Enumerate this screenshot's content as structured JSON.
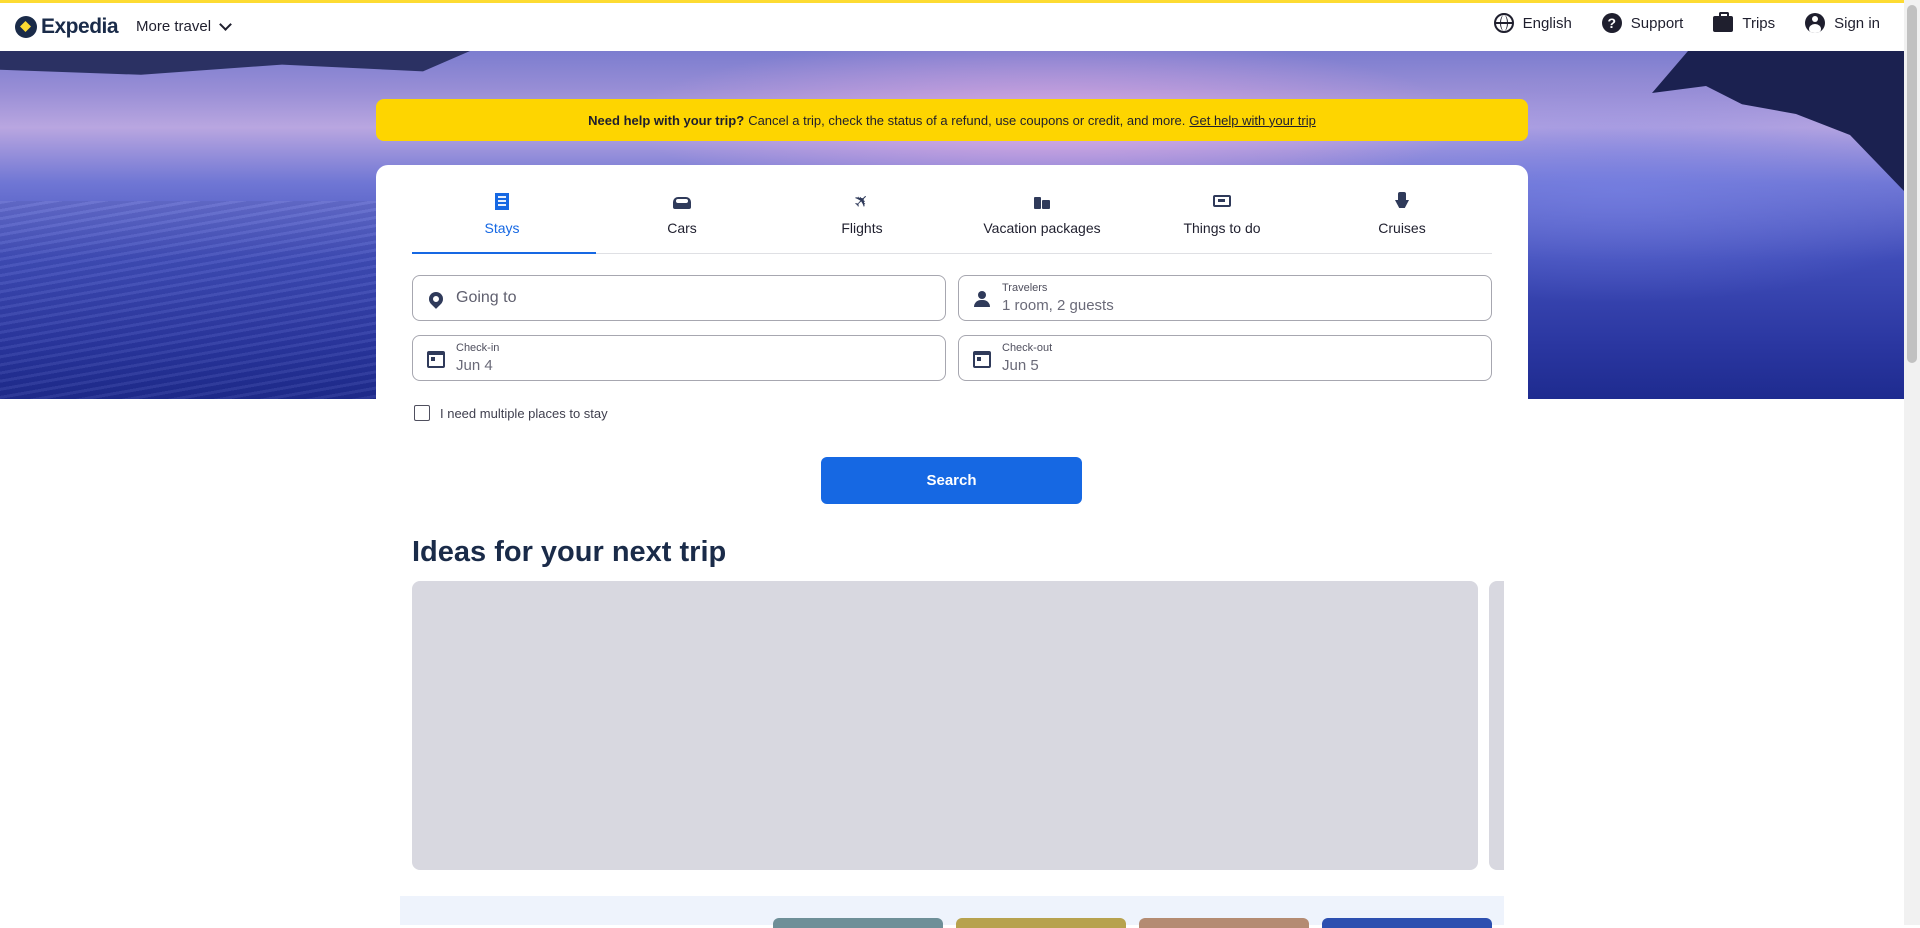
{
  "header": {
    "logo_text": "Expedia",
    "more_travel": "More travel",
    "nav": {
      "language": "English",
      "support": "Support",
      "trips": "Trips",
      "sign_in": "Sign in"
    }
  },
  "banner": {
    "bold": "Need help with your trip?",
    "text": "Cancel a trip, check the status of a refund, use coupons or credit, and more.",
    "link": "Get help with your trip"
  },
  "tabs": [
    {
      "label": "Stays",
      "icon": "building-icon",
      "active": true
    },
    {
      "label": "Cars",
      "icon": "car-icon"
    },
    {
      "label": "Flights",
      "icon": "plane-icon"
    },
    {
      "label": "Vacation packages",
      "icon": "luggage-icon"
    },
    {
      "label": "Things to do",
      "icon": "ticket-icon"
    },
    {
      "label": "Cruises",
      "icon": "ship-icon"
    }
  ],
  "form": {
    "going_to_placeholder": "Going to",
    "travelers_label": "Travelers",
    "travelers_value": "1 room, 2 guests",
    "checkin_label": "Check-in",
    "checkin_value": "Jun 4",
    "checkout_label": "Check-out",
    "checkout_value": "Jun 5",
    "multi_label": "I need multiple places to stay",
    "search_label": "Search"
  },
  "ideas": {
    "title": "Ideas for your next trip"
  },
  "colors": {
    "accent": "#1668e3",
    "banner": "#fed500",
    "brand_navy": "#1a2b49"
  }
}
